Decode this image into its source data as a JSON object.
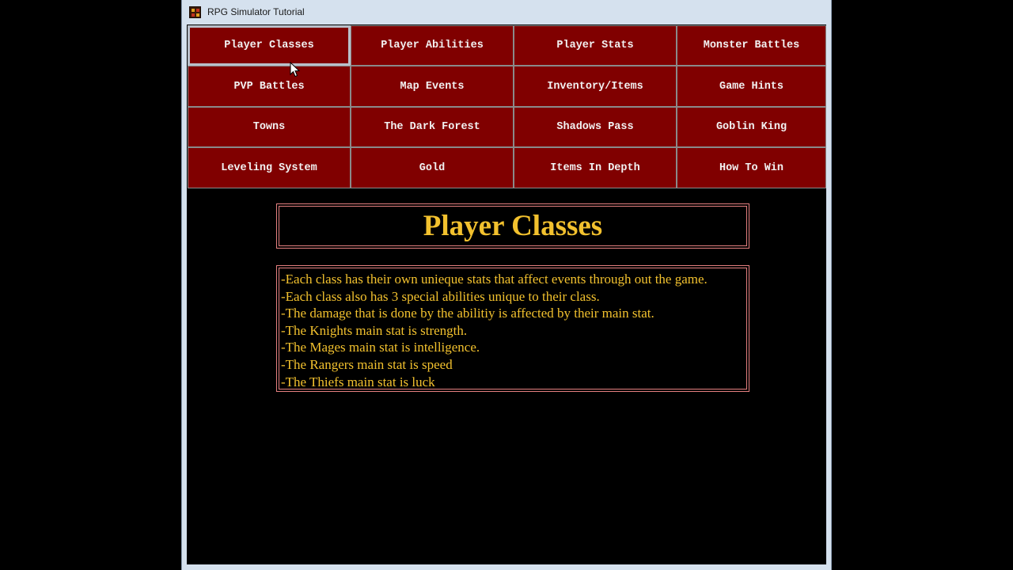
{
  "window": {
    "title": "RPG Simulator Tutorial",
    "icon": "app-icon"
  },
  "nav": {
    "buttons": [
      {
        "label": "Player Classes",
        "active": true
      },
      {
        "label": "Player Abilities"
      },
      {
        "label": "Player Stats"
      },
      {
        "label": "Monster Battles"
      },
      {
        "label": "PVP Battles"
      },
      {
        "label": "Map Events"
      },
      {
        "label": "Inventory/Items"
      },
      {
        "label": "Game Hints"
      },
      {
        "label": "Towns"
      },
      {
        "label": "The Dark Forest"
      },
      {
        "label": "Shadows Pass"
      },
      {
        "label": "Goblin King"
      },
      {
        "label": "Leveling System"
      },
      {
        "label": "Gold"
      },
      {
        "label": "Items In Depth"
      },
      {
        "label": "How To Win"
      }
    ]
  },
  "page": {
    "heading": "Player Classes",
    "lines": [
      "-Each class has their own unieque stats that affect events through out the game.",
      "-Each class also has 3 special abilities unique to their class.",
      "-The damage that is done by the abilitiy is affected by their main stat.",
      "-The Knights main stat is strength.",
      "-The Mages main stat is intelligence.",
      "-The Rangers main stat is speed",
      "-The Thiefs main stat is luck"
    ]
  },
  "colors": {
    "button_bg": "#800000",
    "button_text": "#f2f2f2",
    "heading_text": "#f2c12e",
    "box_border": "#e58080",
    "background": "#000000"
  }
}
